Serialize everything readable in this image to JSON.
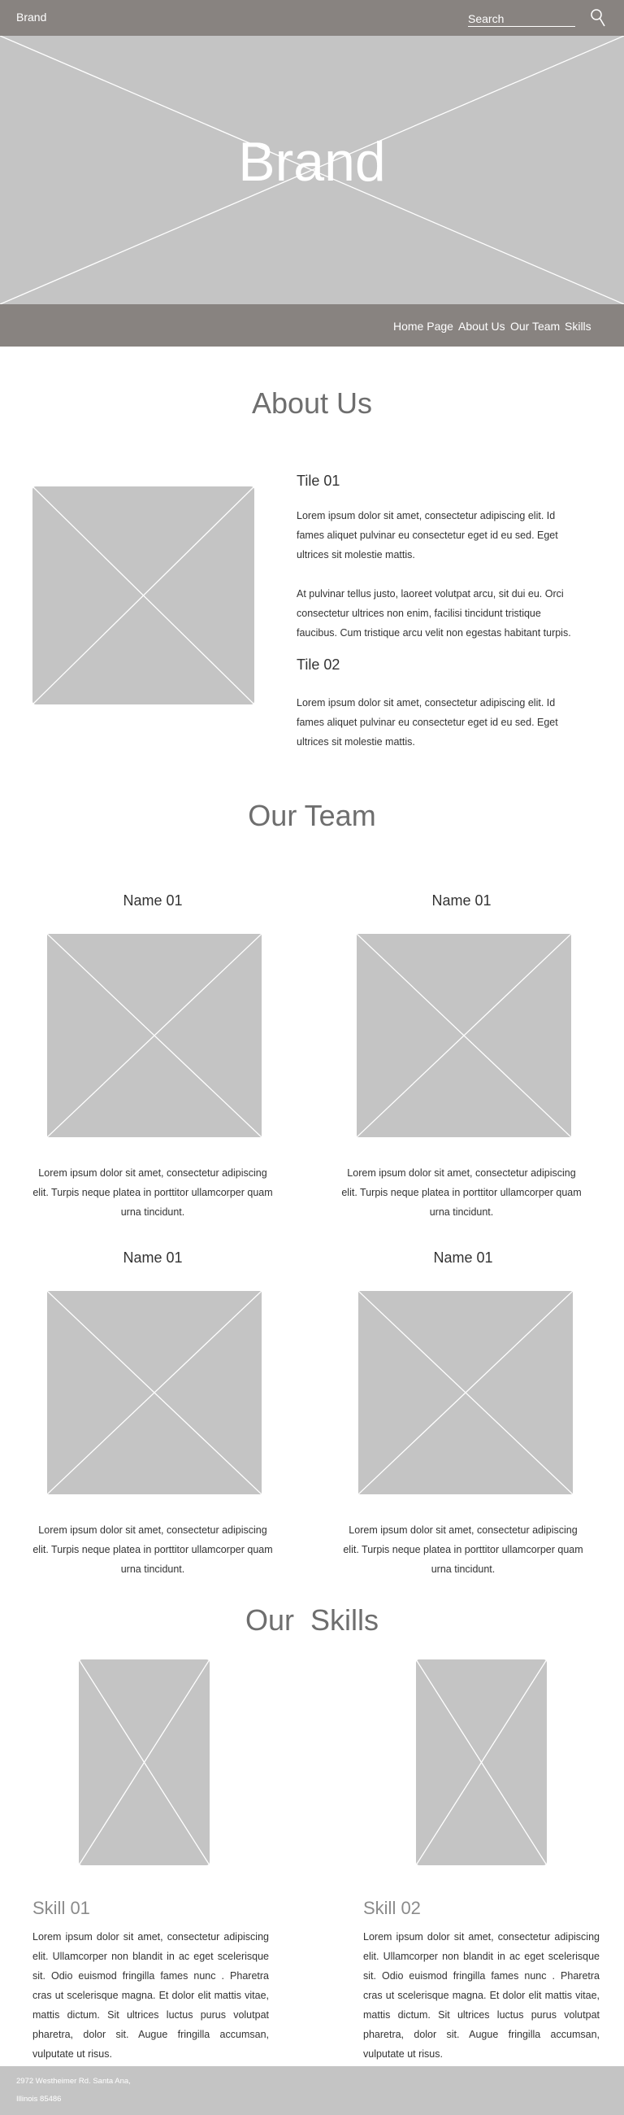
{
  "header": {
    "brand": "Brand",
    "search_placeholder": "Search",
    "search_icon": "magnifier-icon"
  },
  "hero": {
    "title": "Brand"
  },
  "nav": {
    "items": [
      "Home Page",
      "About Us",
      "Our Team",
      "Skills"
    ]
  },
  "about": {
    "title": "About Us",
    "tile1_title": "Tile 01",
    "tile1_para1": "Lorem ipsum dolor sit amet, consectetur adipiscing elit. Id fames aliquet pulvinar eu consectetur eget id eu sed. Eget ultrices sit molestie mattis.",
    "tile1_para2": "At pulvinar tellus justo, laoreet volutpat arcu, sit dui eu. Orci consectetur ultrices non enim, facilisi tincidunt tristique faucibus. Cum tristique arcu velit non egestas habitant turpis.",
    "tile2_title": "Tile 02",
    "tile2_para": "Lorem ipsum dolor sit amet, consectetur adipiscing elit. Id fames aliquet pulvinar eu consectetur eget id eu sed. Eget ultrices sit molestie mattis."
  },
  "team": {
    "title": "Our Team",
    "members": [
      {
        "name": "Name 01",
        "bio": "Lorem ipsum dolor sit amet, consectetur adipiscing elit. Turpis neque platea in porttitor ullamcorper quam urna tincidunt."
      },
      {
        "name": "Name 01",
        "bio": "Lorem ipsum dolor sit amet, consectetur adipiscing elit. Turpis neque platea in porttitor ullamcorper quam urna tincidunt."
      },
      {
        "name": "Name 01",
        "bio": "Lorem ipsum dolor sit amet, consectetur adipiscing elit. Turpis neque platea in porttitor ullamcorper quam urna tincidunt."
      },
      {
        "name": "Name 01",
        "bio": "Lorem ipsum dolor sit amet, consectetur adipiscing elit. Turpis neque platea in porttitor ullamcorper quam urna tincidunt."
      }
    ]
  },
  "skills": {
    "title": "Our  Skills",
    "items": [
      {
        "title": "Skill 01",
        "text": "Lorem ipsum dolor sit amet, consectetur adipiscing elit. Ullamcorper non blandit in ac eget scelerisque sit. Odio euismod fringilla fames nunc . Pharetra cras ut scelerisque magna. Et dolor elit mattis vitae, mattis dictum. Sit ultrices luctus purus volutpat pharetra, dolor sit. Augue fringilla accumsan, vulputate ut risus."
      },
      {
        "title": "Skill 02",
        "text": "Lorem ipsum dolor sit amet, consectetur adipiscing elit. Ullamcorper non blandit in ac eget scelerisque sit. Odio euismod fringilla fames nunc . Pharetra cras ut scelerisque magna. Et dolor elit mattis vitae, mattis dictum. Sit ultrices luctus purus volutpat pharetra, dolor sit. Augue fringilla accumsan, vulputate ut risus."
      }
    ]
  },
  "footer": {
    "address_line1": "2972 Westheimer Rd. Santa Ana,",
    "address_line2": "Illinois 85486"
  },
  "colors": {
    "bar_gray": "#888380",
    "placeholder_gray": "#c4c4c4",
    "white": "#ffffff"
  }
}
